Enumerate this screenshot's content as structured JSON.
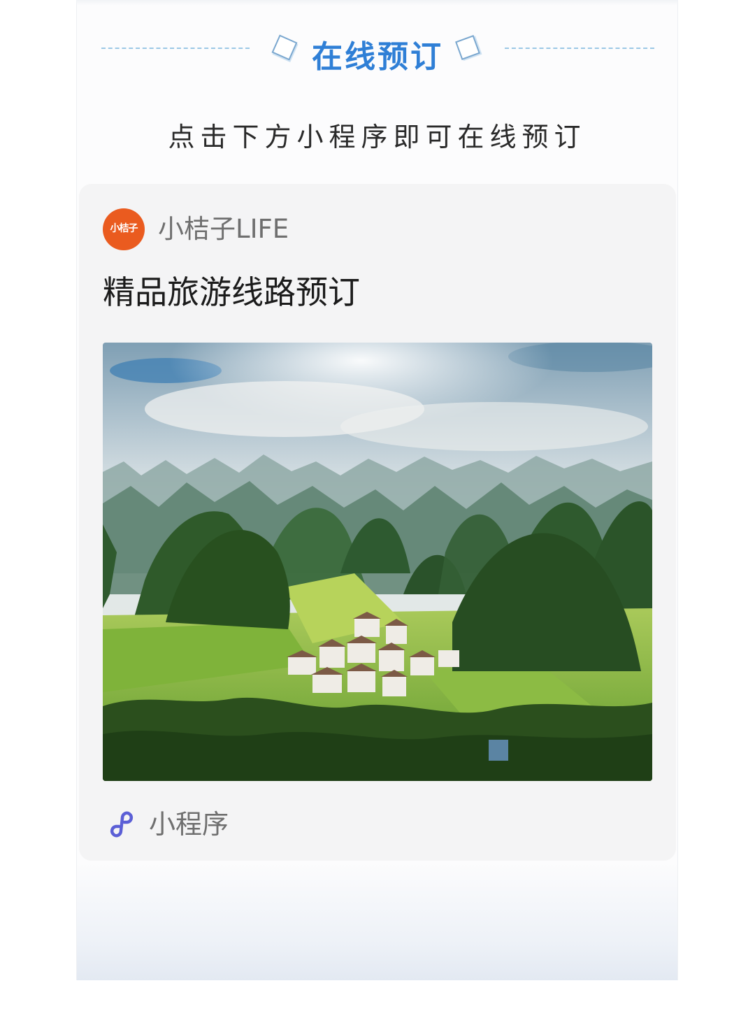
{
  "section": {
    "title": "在线预订",
    "instruction": "点击下方小程序即可在线预订"
  },
  "miniprogram_card": {
    "avatar_text": "小桔子",
    "app_name": "小桔子LIFE",
    "title": "精品旅游线路预订",
    "footer_label": "小程序",
    "footer_icon": "miniprogram-link-icon"
  },
  "colors": {
    "title_blue": "#2f7fd6",
    "avatar_orange": "#ea5b1f",
    "miniprogram_icon": "#5b5fd6"
  }
}
